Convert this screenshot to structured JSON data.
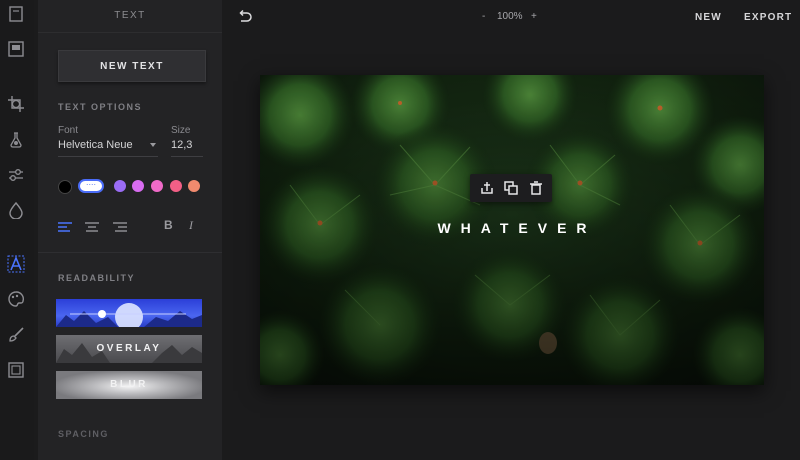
{
  "panel": {
    "title": "TEXT",
    "new_text_button": "NEW TEXT",
    "text_options_heading": "TEXT OPTIONS",
    "font_label": "Font",
    "font_value": "Helvetica Neue",
    "size_label": "Size",
    "size_value": "12,3",
    "selected_swatch_text": "....",
    "bold_label": "B",
    "italic_label": "I",
    "readability_heading": "READABILITY",
    "presets": [
      {
        "label": ""
      },
      {
        "label": "OVERLAY"
      },
      {
        "label": "BLUR"
      }
    ],
    "spacing_heading": "SPACING",
    "colors": [
      "#000000",
      "#ffffff",
      "#9a6cf5",
      "#d86cf0",
      "#f06ac8",
      "#f35f86",
      "#f08a6e"
    ]
  },
  "topbar": {
    "zoom_minus": "-",
    "zoom_value": "100%",
    "zoom_plus": "+",
    "new_label": "NEW",
    "export_label": "EXPORT"
  },
  "canvas": {
    "overlay_text": "WHATEVER"
  },
  "rail_icons": [
    "document-icon",
    "image-icon",
    "crop-icon",
    "flask-icon",
    "sliders-icon",
    "drop-icon",
    "text-icon",
    "palette-icon",
    "brush-icon",
    "frame-icon"
  ]
}
